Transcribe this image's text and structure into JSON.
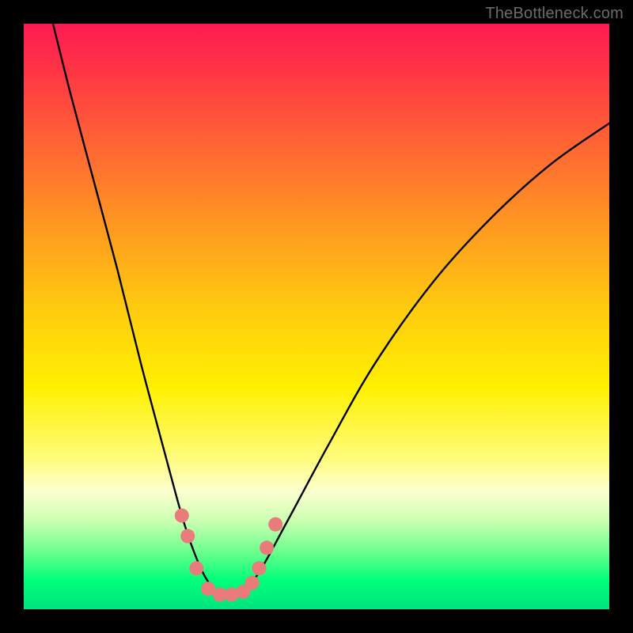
{
  "watermark": "TheBottleneck.com",
  "chart_data": {
    "type": "line",
    "title": "",
    "xlabel": "",
    "ylabel": "",
    "xlim": [
      0,
      100
    ],
    "ylim": [
      0,
      100
    ],
    "grid": false,
    "legend": false,
    "series": [
      {
        "name": "bottleneck-curve",
        "x": [
          5,
          8,
          12,
          16,
          20,
          24,
          27,
          29,
          31,
          33,
          35,
          37,
          40,
          45,
          52,
          60,
          70,
          80,
          90,
          100
        ],
        "y": [
          100,
          88,
          73,
          58,
          42,
          27,
          16,
          10,
          5.5,
          3,
          2.5,
          3,
          6,
          15,
          28,
          42,
          56,
          67,
          76,
          83
        ]
      }
    ],
    "markers": [
      {
        "name": "pink-dots",
        "color": "#e97b7b",
        "points": [
          {
            "x": 27.0,
            "y": 16.0
          },
          {
            "x": 28.0,
            "y": 12.5
          },
          {
            "x": 29.5,
            "y": 7.0
          },
          {
            "x": 31.5,
            "y": 3.5
          },
          {
            "x": 33.5,
            "y": 2.5
          },
          {
            "x": 35.5,
            "y": 2.5
          },
          {
            "x": 37.5,
            "y": 3.0
          },
          {
            "x": 39.0,
            "y": 4.5
          },
          {
            "x": 40.2,
            "y": 7.0
          },
          {
            "x": 41.5,
            "y": 10.5
          },
          {
            "x": 43.0,
            "y": 14.5
          }
        ]
      }
    ]
  }
}
